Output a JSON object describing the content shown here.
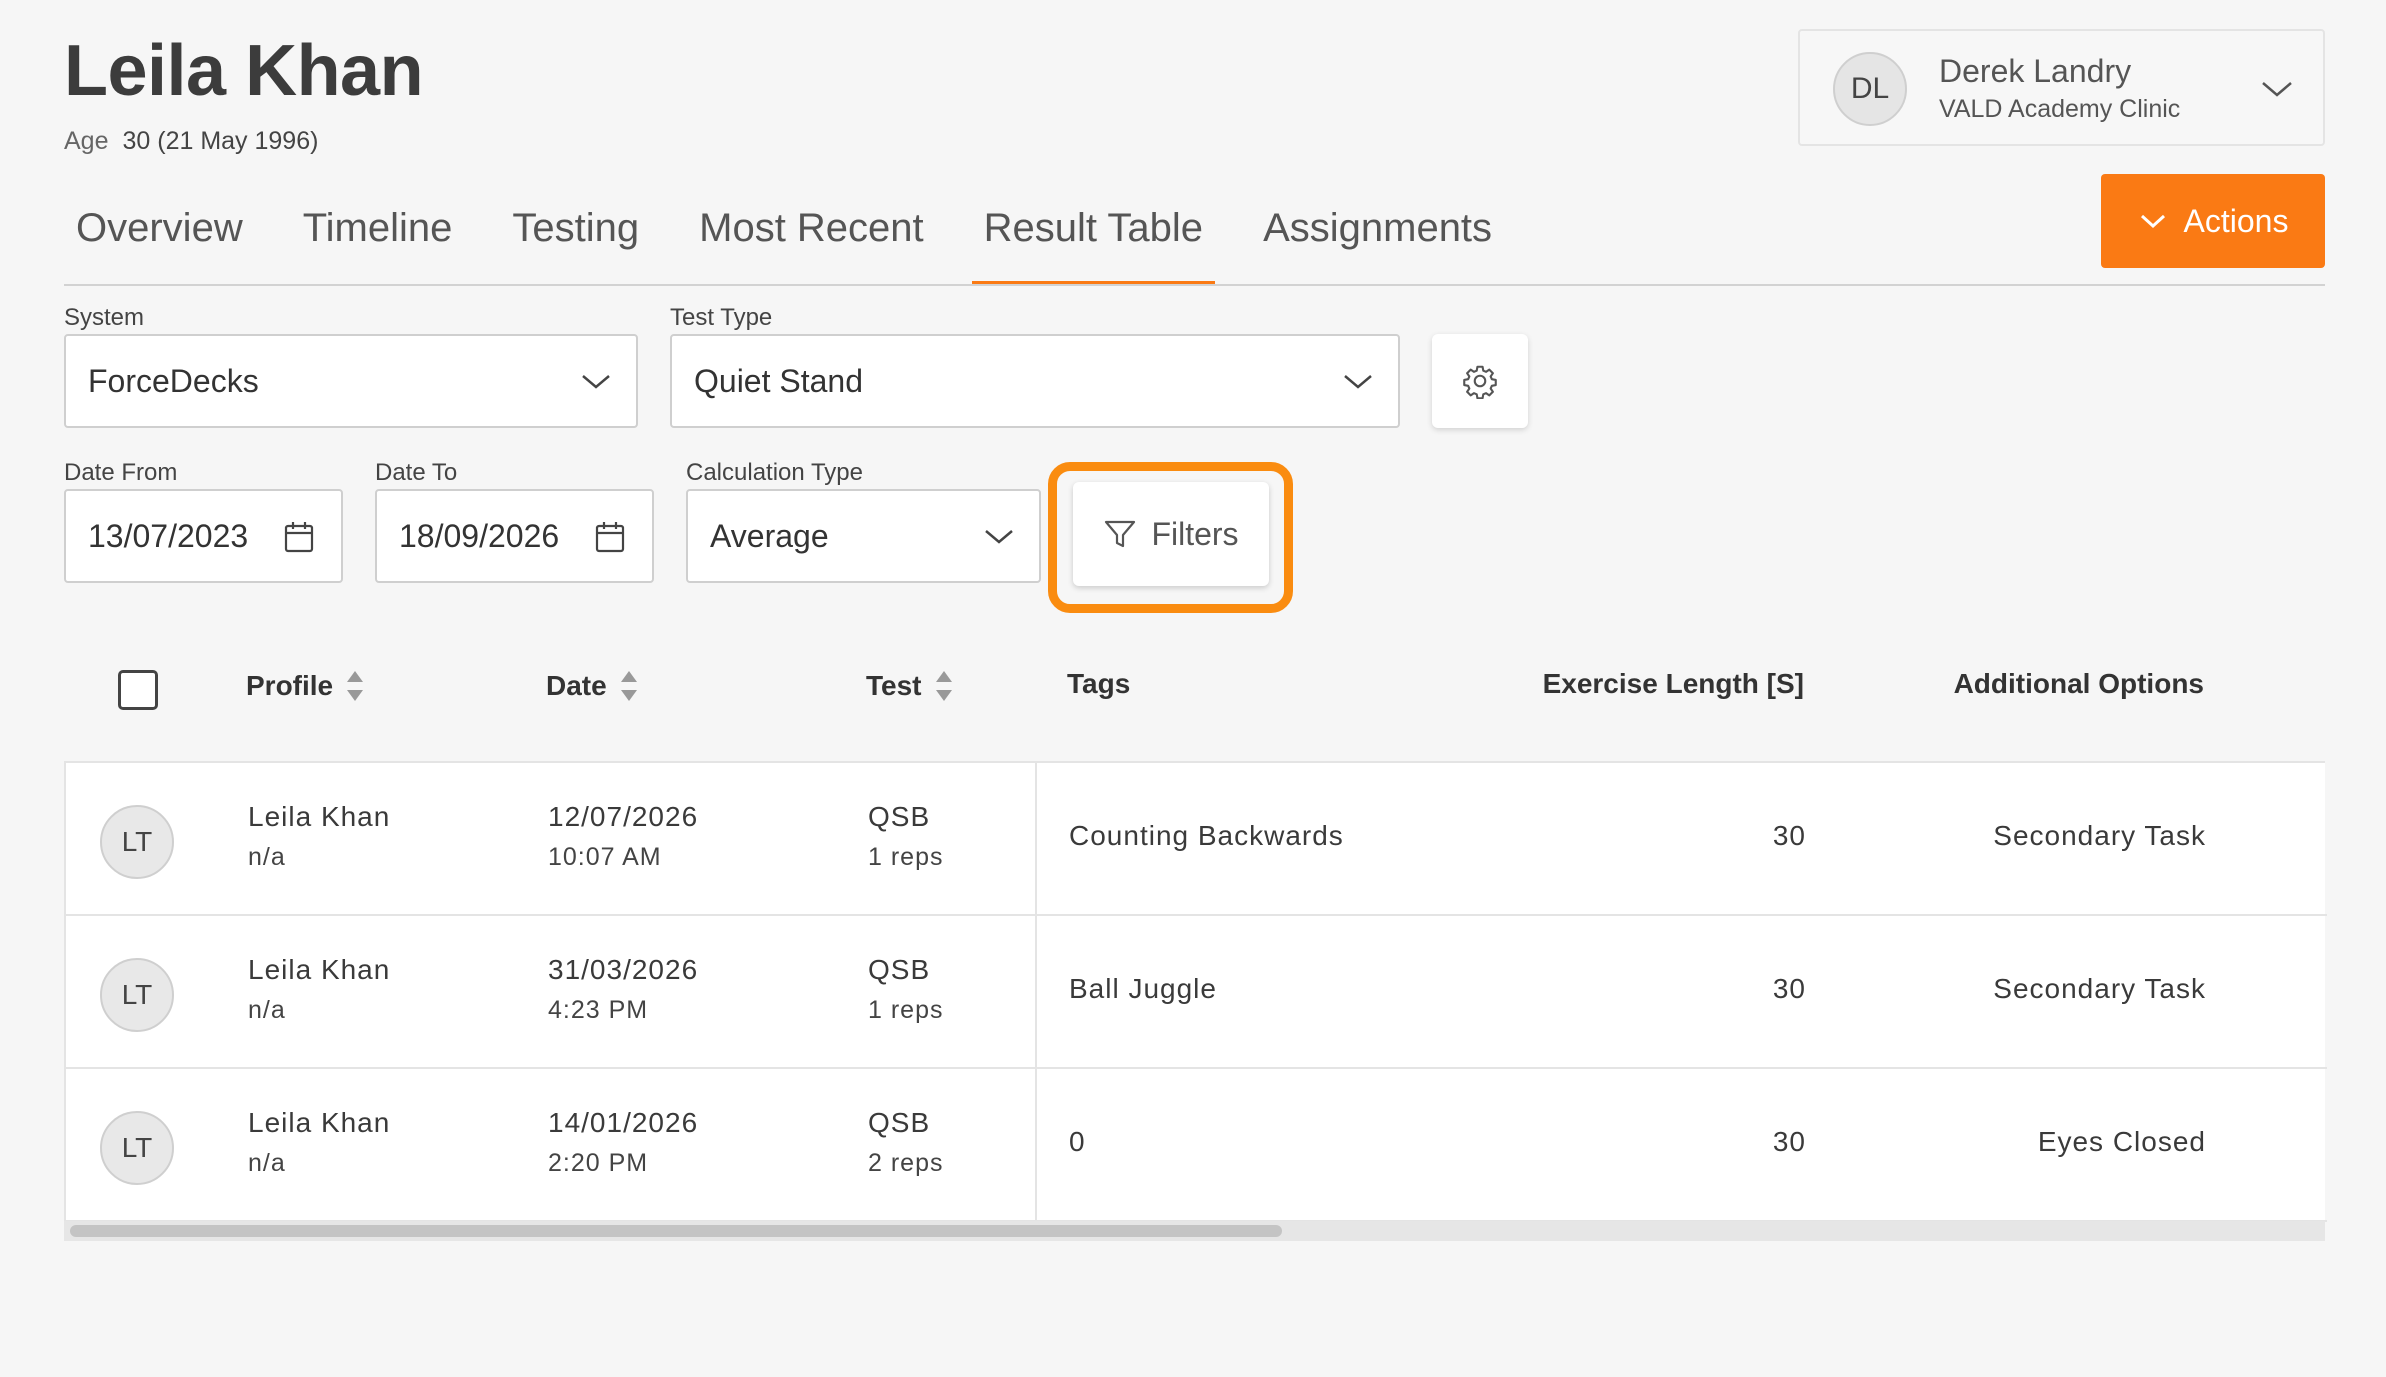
{
  "athlete": {
    "name": "Leila Khan",
    "age_label": "Age",
    "age_value": "30 (21 May 1996)"
  },
  "user_card": {
    "initials": "DL",
    "name": "Derek Landry",
    "clinic": "VALD Academy Clinic",
    "chevron_icon": "chevron-down-icon"
  },
  "actions": {
    "label": "Actions",
    "icon": "chevron-down-icon",
    "color": "#fa7a14"
  },
  "tabs": [
    {
      "label": "Overview",
      "active": false
    },
    {
      "label": "Timeline",
      "active": false
    },
    {
      "label": "Testing",
      "active": false
    },
    {
      "label": "Most Recent",
      "active": false
    },
    {
      "label": "Result Table",
      "active": true
    },
    {
      "label": "Assignments",
      "active": false
    }
  ],
  "filters": {
    "system": {
      "label": "System",
      "value": "ForceDecks"
    },
    "test_type": {
      "label": "Test Type",
      "value": "Quiet Stand"
    },
    "settings_icon": "gear-icon",
    "date_from": {
      "label": "Date From",
      "value": "13/07/2023",
      "icon": "calendar-icon"
    },
    "date_to": {
      "label": "Date To",
      "value": "18/09/2026",
      "icon": "calendar-icon"
    },
    "calculation_type": {
      "label": "Calculation Type",
      "value": "Average"
    },
    "filters_button": {
      "label": "Filters",
      "icon": "funnel-icon",
      "highlight_color": "#fa8c10"
    }
  },
  "table": {
    "columns": {
      "profile": "Profile",
      "date": "Date",
      "test": "Test",
      "tags": "Tags",
      "exercise_length": "Exercise Length [S]",
      "additional_options": "Additional Options"
    },
    "rows": [
      {
        "initials": "LT",
        "name": "Leila Khan",
        "group": "n/a",
        "date": "12/07/2026",
        "time": "10:07 AM",
        "test": "QSB",
        "reps": "1 reps",
        "tags": "Counting Backwards",
        "exercise_length": "30",
        "additional_options": "Secondary Task"
      },
      {
        "initials": "LT",
        "name": "Leila Khan",
        "group": "n/a",
        "date": "31/03/2026",
        "time": "4:23 PM",
        "test": "QSB",
        "reps": "1 reps",
        "tags": "Ball Juggle",
        "exercise_length": "30",
        "additional_options": "Secondary Task"
      },
      {
        "initials": "LT",
        "name": "Leila Khan",
        "group": "n/a",
        "date": "14/01/2026",
        "time": "2:20 PM",
        "test": "QSB",
        "reps": "2 reps",
        "tags": "0",
        "exercise_length": "30",
        "additional_options": "Eyes Closed"
      }
    ]
  }
}
